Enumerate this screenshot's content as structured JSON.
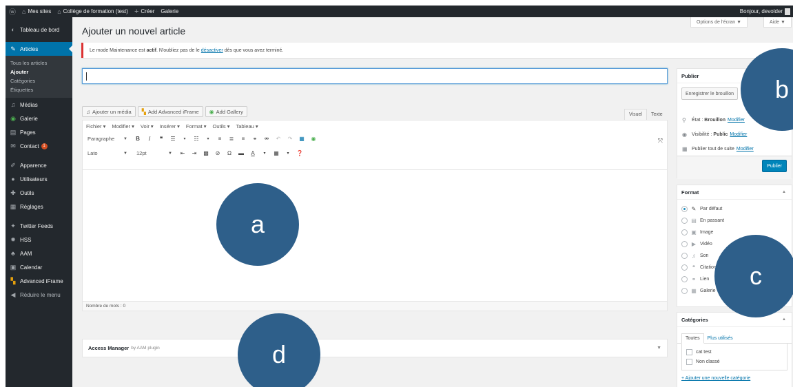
{
  "adminbar": {
    "wp_icon": "wordpress-logo-icon",
    "sites": "Mes sites",
    "site_name": "Collège de formation (test)",
    "create": "Créer",
    "gallery": "Galerie",
    "greeting": "Bonjour, devolder"
  },
  "sidebar": {
    "dashboard": "Tableau de bord",
    "articles": "Articles",
    "submenu": [
      "Tous les articles",
      "Ajouter",
      "Catégories",
      "Étiquettes"
    ],
    "medias": "Médias",
    "galerie": "Galerie",
    "pages": "Pages",
    "contact": "Contact",
    "contact_badge": "1",
    "apparence": "Apparence",
    "utilisateurs": "Utilisateurs",
    "outils": "Outils",
    "reglages": "Réglages",
    "twitter": "Twitter Feeds",
    "hss": "HSS",
    "aam": "AAM",
    "calendar": "Calendar",
    "iframe": "Advanced iFrame",
    "collapse": "Réduire le menu"
  },
  "header": {
    "title": "Ajouter un nouvel article",
    "screen_options": "Options de l'écran ▼",
    "help": "Aide ▼"
  },
  "notice": {
    "part1": "Le mode Maintenance est",
    "bold": "actif",
    "part2": ". N'oubliez pas de le",
    "link": "désactiver",
    "part3": "dès que vous avez terminé."
  },
  "editor": {
    "title_value": "",
    "media_buttons": [
      "Ajouter un média",
      "Add Advanced iFrame",
      "Add Gallery"
    ],
    "tabs": [
      "Visuel",
      "Texte"
    ],
    "menubar": [
      "Fichier ▾",
      "Modifier ▾",
      "Voir ▾",
      "Insérer ▾",
      "Format ▾",
      "Outils ▾",
      "Tableau ▾"
    ],
    "paragraph_select": "Paragraphe",
    "font_select": "Lato",
    "size_select": "12pt",
    "word_count": "Nombre de mots : 0"
  },
  "aam_box": {
    "title": "Access Manager",
    "subtitle": "by AAM plugin"
  },
  "publish": {
    "title": "Publier",
    "save_draft": "Enregistrer le brouillon",
    "status_label": "État :",
    "status_value": "Brouillon",
    "visibility_label": "Visibilité :",
    "visibility_value": "Public",
    "schedule": "Publier tout de suite",
    "modify": "Modifier",
    "publish_button": "Publier"
  },
  "format": {
    "title": "Format",
    "options": [
      "Par défaut",
      "En passant",
      "Image",
      "Vidéo",
      "Son",
      "Citation",
      "Lien",
      "Galerie"
    ],
    "selected_index": 0
  },
  "categories": {
    "title": "Catégories",
    "tab_all": "Toutes",
    "tab_popular": "Plus utilisés",
    "items": [
      "cat test",
      "Non classé"
    ],
    "add_new": "+ Ajouter une nouvelle catégorie"
  },
  "annotations": [
    "a",
    "b",
    "c",
    "d"
  ],
  "colors": {
    "admin_dark": "#23282d",
    "accent": "#0073aa",
    "annotation": "#2e5f8a",
    "notice_error": "#dc3232"
  }
}
